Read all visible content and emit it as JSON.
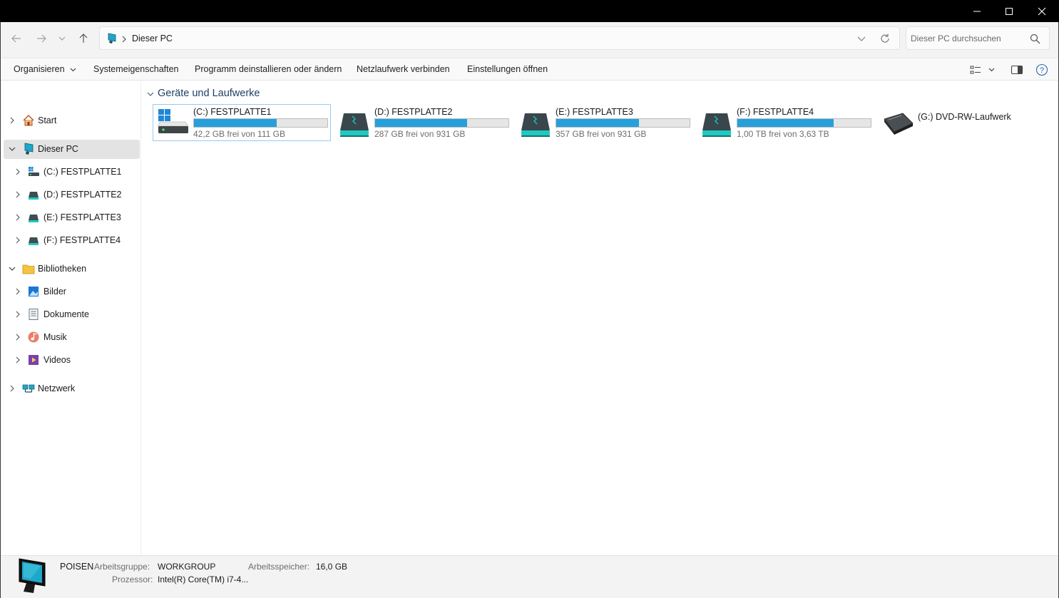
{
  "window": {
    "minimize_icon": "minimize-icon",
    "maximize_icon": "maximize-icon",
    "close_icon": "close-icon"
  },
  "address_bar": {
    "location": "Dieser PC",
    "search_placeholder": "Dieser PC durchsuchen"
  },
  "command_bar": {
    "organize": "Organisieren",
    "system_properties": "Systemeigenschaften",
    "uninstall": "Programm deinstallieren oder ändern",
    "map_network_drive": "Netzlaufwerk verbinden",
    "open_settings": "Einstellungen öffnen"
  },
  "sidebar": {
    "items": [
      {
        "label": "Start",
        "icon": "home-icon"
      },
      {
        "label": "Dieser PC",
        "icon": "computer-icon",
        "selected": true
      },
      {
        "label": "(C:) FESTPLATTE1",
        "icon": "windows-drive-icon"
      },
      {
        "label": "(D:) FESTPLATTE2",
        "icon": "hard-drive-icon"
      },
      {
        "label": "(E:) FESTPLATTE3",
        "icon": "hard-drive-icon"
      },
      {
        "label": "(F:) FESTPLATTE4",
        "icon": "hard-drive-icon"
      },
      {
        "label": "Bibliotheken",
        "icon": "folder-icon"
      },
      {
        "label": "Bilder",
        "icon": "pictures-icon"
      },
      {
        "label": "Dokumente",
        "icon": "documents-icon"
      },
      {
        "label": "Musik",
        "icon": "music-icon"
      },
      {
        "label": "Videos",
        "icon": "videos-icon"
      },
      {
        "label": "Netzwerk",
        "icon": "network-icon"
      }
    ]
  },
  "content": {
    "group_label": "Geräte und Laufwerke",
    "drives": [
      {
        "name": "(C:) FESTPLATTE1",
        "free": "42,2 GB frei von 111 GB",
        "used_fraction": 0.62,
        "icon": "windows-drive-icon",
        "selected": true
      },
      {
        "name": "(D:) FESTPLATTE2",
        "free": "287 GB frei von 931 GB",
        "used_fraction": 0.69,
        "icon": "hard-drive-icon"
      },
      {
        "name": "(E:) FESTPLATTE3",
        "free": "357 GB frei von 931 GB",
        "used_fraction": 0.62,
        "icon": "hard-drive-icon"
      },
      {
        "name": "(F:) FESTPLATTE4",
        "free": "1,00 TB frei von 3,63 TB",
        "used_fraction": 0.72,
        "icon": "hard-drive-icon"
      },
      {
        "name": "(G:) DVD-RW-Laufwerk",
        "icon": "dvd-drive-icon"
      }
    ]
  },
  "details": {
    "computer_name": "POISEN",
    "workgroup_label": "Arbeitsgruppe:",
    "workgroup_value": "WORKGROUP",
    "memory_label": "Arbeitsspeicher:",
    "memory_value": "16,0 GB",
    "processor_label": "Prozessor:",
    "processor_value": "Intel(R) Core(TM) i7-4..."
  },
  "colors": {
    "accent": "#26a0da",
    "selection": "#e3e3e3",
    "group_header": "#1f3f66"
  }
}
